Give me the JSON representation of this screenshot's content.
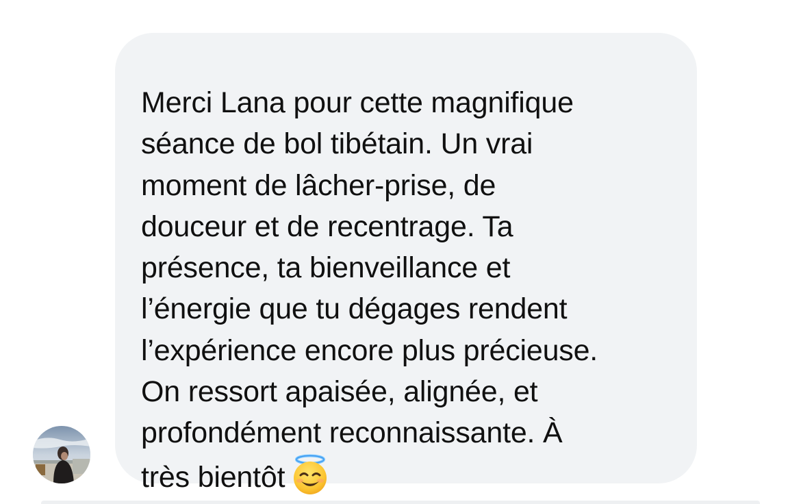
{
  "conversation": {
    "message": {
      "lines": [
        "Merci Lana pour cette magnifique",
        "séance de bol tibétain. Un vrai",
        "moment de lâcher-prise, de",
        "douceur et de recentrage. Ta",
        "présence, ta bienveillance et",
        "l’énergie que tu dégages rendent",
        "l’expérience encore plus précieuse.",
        "On ressort apaisée, alignée, et",
        "profondément reconnaissante. À",
        "très bientôt"
      ],
      "emoji": "smiling-face-with-halo",
      "bubble_color": "#f1f3f5",
      "text_color": "#101010"
    },
    "sender": {
      "avatar": "profile-photo"
    }
  }
}
